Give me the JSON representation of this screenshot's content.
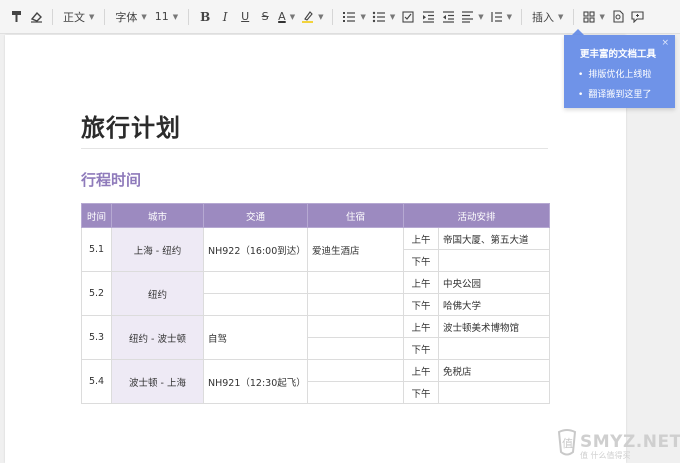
{
  "toolbar": {
    "paragraph_style": "正文",
    "font_family": "字体",
    "font_size": "11",
    "insert_label": "插入",
    "icons": [
      "format-painter-icon",
      "clear-format-icon",
      "bold-icon",
      "italic-icon",
      "underline-icon",
      "strikethrough-icon",
      "font-color-icon",
      "highlight-icon",
      "numbered-list-icon",
      "bullet-list-icon",
      "checklist-icon",
      "indent-increase-icon",
      "indent-decrease-icon",
      "align-icon",
      "line-spacing-icon",
      "grid-icon",
      "export-icon",
      "comment-icon"
    ],
    "glyphs": {
      "bold": "B",
      "italic": "I",
      "underline": "U",
      "strike": "S",
      "font_color": "A"
    }
  },
  "document": {
    "title": "旅行计划",
    "section": "行程时间",
    "table": {
      "headers": [
        "时间",
        "城市",
        "交通",
        "住宿",
        "活动安排"
      ],
      "rows": [
        {
          "date": "5.1",
          "city": "上海 - 纽约",
          "transport": "NH922（16:00到达）",
          "lodging": "爱迪生酒店",
          "am": "上午",
          "am_activity": "帝国大厦、第五大道",
          "pm": "下午",
          "pm_activity": ""
        },
        {
          "date": "5.2",
          "city": "纽约",
          "transport": "",
          "lodging": "",
          "am": "上午",
          "am_activity": "中央公园",
          "pm": "下午",
          "pm_activity": "哈佛大学"
        },
        {
          "date": "5.3",
          "city": "纽约 - 波士顿",
          "transport": "自驾",
          "lodging": "",
          "am": "上午",
          "am_activity": "波士顿美术博物馆",
          "pm": "下午",
          "pm_activity": ""
        },
        {
          "date": "5.4",
          "city": "波士顿 - 上海",
          "transport": "NH921（12:30起飞）",
          "lodging": "",
          "am": "上午",
          "am_activity": "免税店",
          "pm": "下午",
          "pm_activity": ""
        }
      ]
    }
  },
  "popup": {
    "title": "更丰富的文档工具",
    "close": "×",
    "items": [
      "排版优化上线啦",
      "翻译搬到这里了"
    ]
  },
  "watermark": {
    "text": "SMYZ.NET",
    "sub": "值 什么值得买"
  },
  "colors": {
    "accent": "#9c8ac0",
    "section_title": "#8f7bbb",
    "popup_bg": "#6f93e8",
    "city_cell_bg": "#eeeaf5"
  }
}
